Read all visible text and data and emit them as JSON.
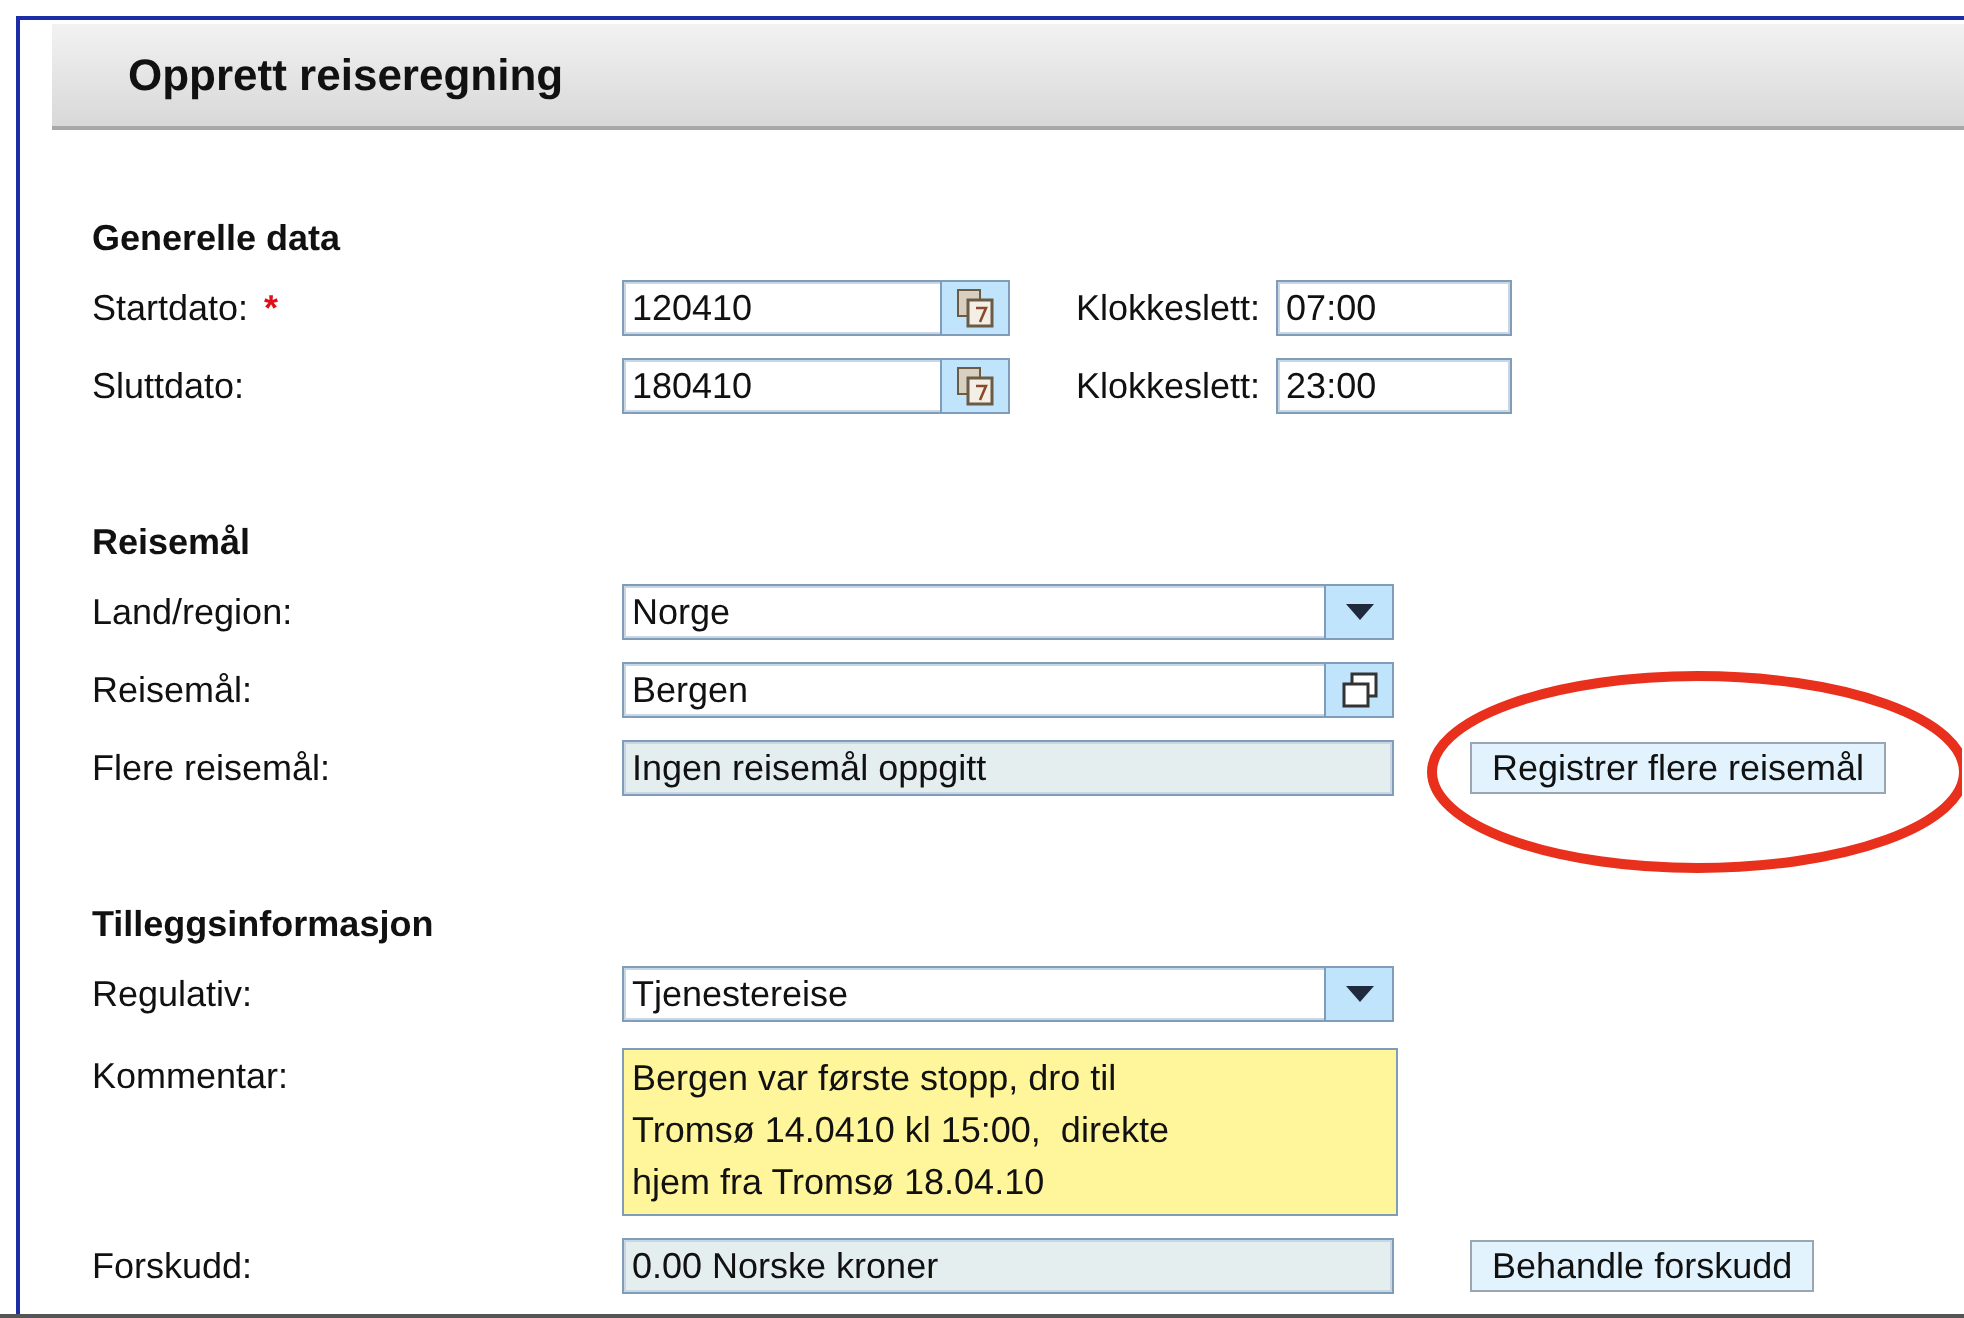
{
  "page": {
    "title": "Opprett reiseregning"
  },
  "sections": [
    {
      "title": "Generelle data",
      "rows": [
        {
          "label": "Startdato:",
          "required_mark": "*",
          "fields": [
            {
              "kind": "date",
              "value": "120410"
            },
            {
              "kind": "label",
              "text": "Klokkeslett:"
            },
            {
              "kind": "time",
              "value": "07:00"
            }
          ]
        },
        {
          "label": "Sluttdato:",
          "fields": [
            {
              "kind": "date",
              "value": "180410"
            },
            {
              "kind": "label",
              "text": "Klokkeslett:"
            },
            {
              "kind": "time",
              "value": "23:00"
            }
          ]
        }
      ]
    },
    {
      "title": "Reisemål",
      "rows": [
        {
          "label": "Land/region:",
          "fields": [
            {
              "kind": "select",
              "value": "Norge"
            }
          ]
        },
        {
          "label": "Reisemål:",
          "fields": [
            {
              "kind": "valuehelp",
              "value": "Bergen"
            }
          ]
        },
        {
          "label": "Flere reisemål:",
          "fields": [
            {
              "kind": "readonly",
              "value": "Ingen reisemål oppgitt"
            },
            {
              "kind": "button",
              "text": "Registrer flere reisemål",
              "highlighted": true
            }
          ]
        }
      ]
    },
    {
      "title": "Tilleggsinformasjon",
      "rows": [
        {
          "label": "Regulativ:",
          "fields": [
            {
              "kind": "select",
              "value": "Tjenestereise"
            }
          ]
        },
        {
          "label": "Kommentar:",
          "fields": [
            {
              "kind": "textarea",
              "value": "Bergen var første stopp, dro til\nTromsø 14.0410 kl 15:00,  direkte\nhjem fra Tromsø 18.04.10"
            }
          ]
        },
        {
          "label": "Forskudd:",
          "fields": [
            {
              "kind": "readonly",
              "value": "0.00 Norske kroner"
            },
            {
              "kind": "button",
              "text": "Behandle forskudd",
              "highlighted": false
            }
          ]
        }
      ]
    }
  ]
}
